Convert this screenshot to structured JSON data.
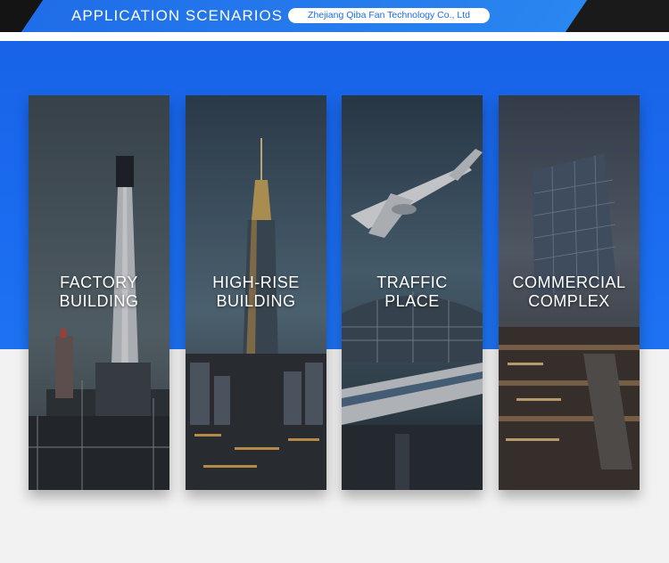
{
  "header": {
    "title": "APPLICATION SCENARIOS",
    "company": "Zhejiang Qiba Fan Technology Co., Ltd"
  },
  "colors": {
    "accent_blue": "#1b6cf0",
    "header_dark": "#1a1a1a",
    "page_background": "#f2f2f2"
  },
  "scenarios": [
    {
      "line1": "FACTORY",
      "line2": "BUILDING",
      "image": "factory-chimney-image"
    },
    {
      "line1": "HIGH-RISE",
      "line2": "BUILDING",
      "image": "skyscraper-city-image"
    },
    {
      "line1": "TRAFFIC",
      "line2": "PLACE",
      "image": "airplane-train-station-image"
    },
    {
      "line1": "COMMERCIAL",
      "line2": "COMPLEX",
      "image": "shopping-mall-image"
    }
  ]
}
